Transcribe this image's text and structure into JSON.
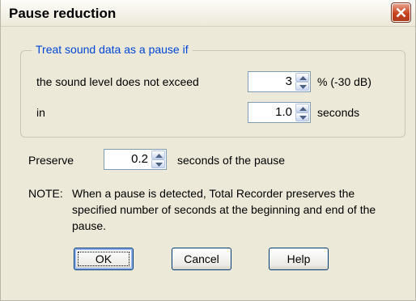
{
  "window": {
    "title": "Pause reduction"
  },
  "group": {
    "legend": "Treat sound data as a pause if",
    "level_label": "the sound level does not exceed",
    "level_value": "3",
    "level_unit": "% (-30 dB)",
    "time_label": "in",
    "time_value": "1.0",
    "time_unit": "seconds"
  },
  "preserve": {
    "label": "Preserve",
    "value": "0.2",
    "unit": "seconds of the pause"
  },
  "note": {
    "prefix": "NOTE:",
    "text": "When a pause is detected, Total Recorder preserves the specified number of seconds at the beginning and end of the pause."
  },
  "buttons": {
    "ok": "OK",
    "cancel": "Cancel",
    "help": "Help"
  },
  "icons": {
    "close": "close-icon",
    "up": "spin-up-arrow-icon",
    "down": "spin-down-arrow-icon"
  },
  "colors": {
    "accent": "#0046d5",
    "close_red": "#c7431f",
    "dialog_bg": "#ece9d8"
  }
}
